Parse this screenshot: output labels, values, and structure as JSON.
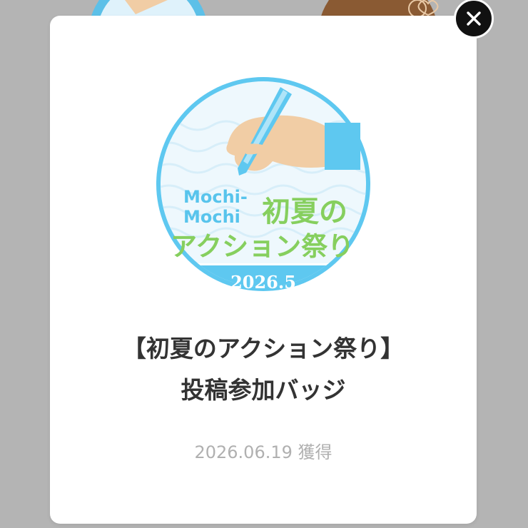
{
  "modal": {
    "badge": {
      "brand_line1": "Mochi-",
      "brand_line2": "Mochi",
      "name_line1": "初夏の",
      "name_line2": "アクション祭り",
      "year_month": "2026.5"
    },
    "title_line1": "【初夏のアクション祭り】",
    "title_line2": "投稿参加バッジ",
    "earned_date": "2026.06.19",
    "earned_label": "獲得"
  },
  "colors": {
    "badge_blue": "#5ec8f0",
    "badge_light": "#e7f6fd",
    "hand_skin": "#f1cda5",
    "badge_text_green": "#86cf5e",
    "badge_text_blue": "#58c4ec",
    "overlay": "#b4b4b4",
    "close_button": "#111111"
  },
  "icons": {
    "close": "close-icon",
    "badge_art": "hand-holding-pen-icon"
  }
}
